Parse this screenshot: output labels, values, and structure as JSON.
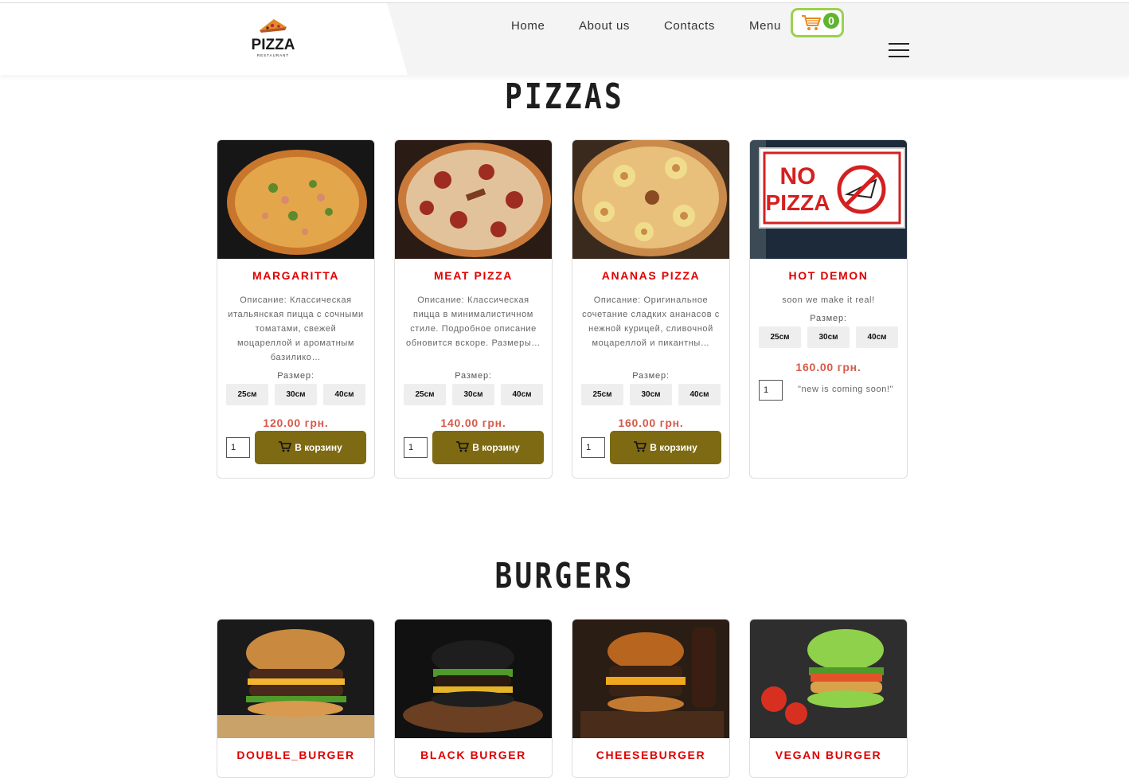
{
  "header": {
    "logo_text": "PIZZA",
    "logo_subtext": "RESTAURANT",
    "nav": [
      {
        "label": "Home"
      },
      {
        "label": "About us"
      },
      {
        "label": "Contacts"
      },
      {
        "label": "Menu"
      }
    ],
    "cart_count": "0"
  },
  "sections": [
    {
      "title": "PIZZAS",
      "products": [
        {
          "name": "MARGARITTA",
          "description": "Описание: Классическая итальянская пицца с сочными томатами, свежей моцареллой и ароматным базилико…",
          "size_label": "Размер:",
          "sizes": [
            "25см",
            "30см",
            "40см"
          ],
          "price": "120.00 грн.",
          "qty": "1",
          "button": "В корзину"
        },
        {
          "name": "MEAT PIZZA",
          "description": "Описание: Классическая пицца в минималистичном стиле. Подробное описание обновится вскоре. Размеры…",
          "size_label": "Размер:",
          "sizes": [
            "25см",
            "30см",
            "40см"
          ],
          "price": "140.00 грн.",
          "qty": "1",
          "button": "В корзину"
        },
        {
          "name": "ANANAS PIZZA",
          "description": "Описание: Оригинальное сочетание сладких ананасов с нежной курицей, сливочной моцареллой и пикантны…",
          "size_label": "Размер:",
          "sizes": [
            "25см",
            "30см",
            "40см"
          ],
          "price": "160.00 грн.",
          "qty": "1",
          "button": "В корзину"
        },
        {
          "name": "HOT DEMON",
          "description": "soon we make it real!",
          "size_label": "Размер:",
          "sizes": [
            "25см",
            "30см",
            "40см"
          ],
          "price": "160.00 грн.",
          "qty": "1",
          "note": "\"new is coming soon!\"",
          "sign_line1": "NO",
          "sign_line2": "PIZZA"
        }
      ]
    },
    {
      "title": "BURGERS",
      "products": [
        {
          "name": "DOUBLE_BURGER"
        },
        {
          "name": "BLACK BURGER"
        },
        {
          "name": "CHEESEBURGER"
        },
        {
          "name": "VEGAN BURGER"
        }
      ]
    }
  ],
  "colors": {
    "accent_red": "#e00000",
    "price": "#d65a4a",
    "button_olive": "#7d6a12",
    "cart_border": "#9bd14e",
    "cart_badge": "#5fb431"
  }
}
